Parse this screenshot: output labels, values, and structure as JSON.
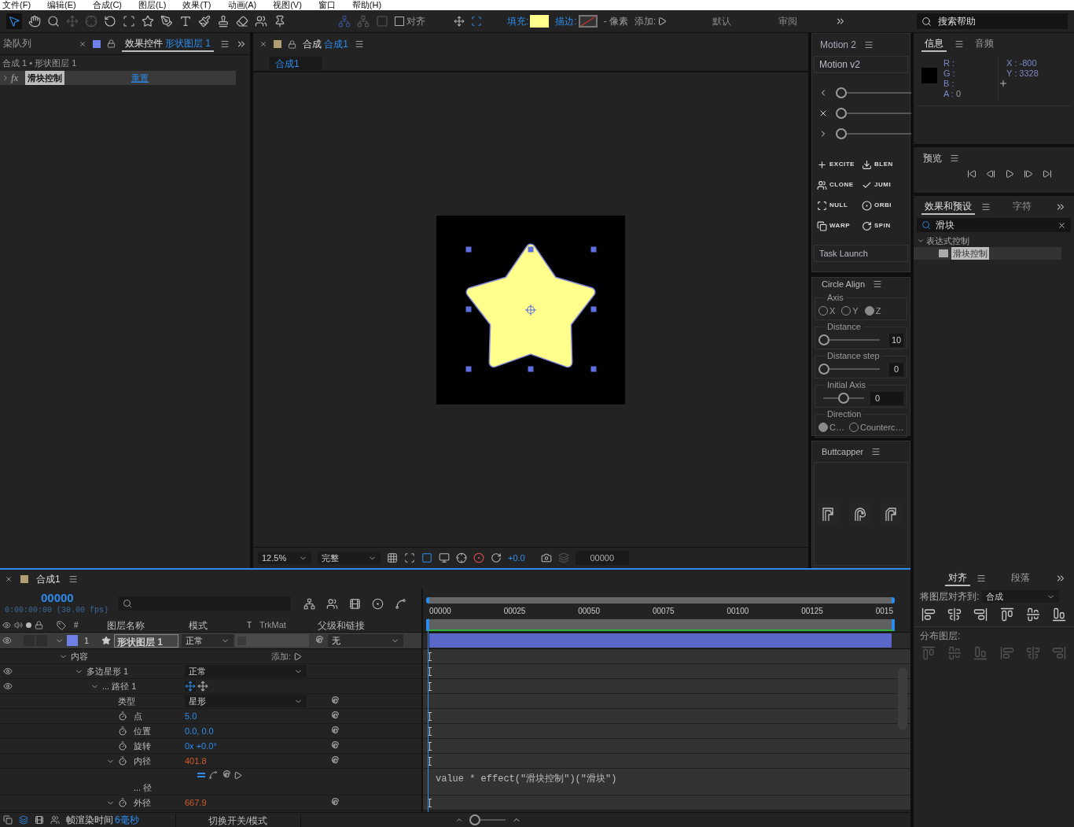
{
  "menu": [
    "文件(F)",
    "编辑(E)",
    "合成(C)",
    "图层(L)",
    "效果(T)",
    "动画(A)",
    "视图(V)",
    "窗口",
    "帮助(H)"
  ],
  "toolbar": {
    "snap": {
      "label": "对齐",
      "checked": false
    },
    "fill_label": "填充:",
    "stroke_label": "描边:",
    "stroke_width": "- 像素",
    "add_label": "添加:",
    "workspaces": [
      {
        "label": "默认",
        "selected": false
      },
      {
        "label": "审阅",
        "selected": false
      }
    ],
    "search": {
      "placeholder": "搜索帮助"
    }
  },
  "effect_controls": {
    "tabs": [
      {
        "label": "染队列",
        "selected": false
      },
      {
        "label": "效果控件",
        "target": "形状图层 1",
        "selected": true
      }
    ],
    "breadcrumb": "合成 1 • 形状图层 1",
    "effects": [
      {
        "icon_text": "fx",
        "name": "滑块控制",
        "reset": "重置",
        "expanded": false
      }
    ]
  },
  "composition": {
    "tab": {
      "label": "合成",
      "target": "合成1"
    },
    "subtabs": [
      {
        "label": "合成1",
        "selected": true
      }
    ],
    "zoom": "12.5%",
    "resolution": "完整",
    "exposure": "+0.0",
    "timecode": "00000"
  },
  "motion": {
    "title": "Motion 2",
    "header": "Motion v2",
    "sliders": [
      {
        "level": 0
      },
      {
        "level": 0
      },
      {
        "level": 0
      }
    ],
    "tools": [
      "EXCITE",
      "BLEN",
      "CLONE",
      "JUMI",
      "NULL",
      "ORBI",
      "WARP",
      "SPIN"
    ],
    "task_launch": "Task Launch"
  },
  "circle_align": {
    "title": "Circle Align",
    "axis": {
      "label": "Axis",
      "options": [
        {
          "label": "X",
          "selected": false
        },
        {
          "label": "Y",
          "selected": false
        },
        {
          "label": "Z",
          "selected": true
        }
      ]
    },
    "distance": {
      "label": "Distance",
      "level": 0,
      "value": "10"
    },
    "distance_step": {
      "label": "Distance step",
      "level": 0,
      "value": "0"
    },
    "initial_axis": {
      "label": "Initial Axis",
      "level": 0.5,
      "value": "0"
    },
    "direction": {
      "label": "Direction",
      "options": [
        {
          "label": "C…",
          "selected": true
        },
        {
          "label": "Counterc…",
          "selected": false
        }
      ]
    }
  },
  "buttcapper": {
    "title": "Buttcapper"
  },
  "info": {
    "tabs": [
      {
        "label": "信息",
        "selected": true
      },
      {
        "label": "音频",
        "selected": false
      }
    ],
    "channels": [
      {
        "label": "R :"
      },
      {
        "label": "G :"
      },
      {
        "label": "B :"
      },
      {
        "label": "A :",
        "value": "0"
      }
    ],
    "x": "X : -800",
    "y": "Y : 3328"
  },
  "preview": {
    "title": "预览"
  },
  "effects_presets": {
    "tabs": [
      {
        "label": "效果和预设",
        "selected": true
      },
      {
        "label": "字符",
        "selected": false
      }
    ],
    "search": {
      "value": "滑块"
    },
    "tree": [
      {
        "label": "表达式控制",
        "expanded": true,
        "children": [
          {
            "label": "滑块控制",
            "selected": true
          }
        ]
      }
    ]
  },
  "align": {
    "tabs": [
      {
        "label": "对齐",
        "selected": true
      },
      {
        "label": "段落",
        "selected": false
      }
    ],
    "align_to_label": "将图层对齐到:",
    "align_to": "合成",
    "distribute_label": "分布图层:"
  },
  "timeline": {
    "tab": "合成1",
    "timecode": "00000",
    "timecode_detail": "0:00:00:00 (30.00 fps)",
    "columns": [
      "#",
      "图层名称",
      "模式",
      "T",
      "TrkMat",
      "父级和链接"
    ],
    "ruler": [
      "00000",
      "00025",
      "00050",
      "00075",
      "00100",
      "00125",
      "0015"
    ],
    "layers": [
      {
        "index": "1",
        "name": "形状图层 1",
        "mode": "正常",
        "parent": "无",
        "expanded": true,
        "selected": true,
        "color": "#6f80e6",
        "properties": [
          {
            "label": "内容",
            "kind": "group",
            "action": "添加:",
            "expanded": true,
            "children": [
              {
                "label": "多边星形 1",
                "kind": "blend_mode",
                "value": "正常",
                "eye": true,
                "expanded": true,
                "children": [
                  {
                    "label": "... 路径 1",
                    "kind": "path_icons",
                    "eye": true,
                    "expanded": true,
                    "children": [
                      {
                        "label": "类型",
                        "kind": "select",
                        "value": "星形"
                      },
                      {
                        "label": "点",
                        "kind": "value",
                        "value": "5.0",
                        "stopwatch": true,
                        "expression": false
                      },
                      {
                        "label": "位置",
                        "kind": "value",
                        "value": "0.0, 0.0",
                        "stopwatch": true,
                        "expression": false
                      },
                      {
                        "label": "旋转",
                        "kind": "value",
                        "value": "0x +0.0°",
                        "stopwatch": true,
                        "expression": false
                      },
                      {
                        "label": "内径",
                        "kind": "value",
                        "value": "401.8",
                        "stopwatch": true,
                        "expression": true,
                        "expanded": true,
                        "children": [
                          {
                            "label": "... 径",
                            "kind": "expression",
                            "expression_text": "value * effect(\"滑块控制\")(\"滑块\")"
                          }
                        ]
                      },
                      {
                        "label": "外径",
                        "kind": "value",
                        "value": "667.9",
                        "stopwatch": true,
                        "expression": true,
                        "expanded": true
                      }
                    ]
                  }
                ]
              }
            ]
          }
        ]
      }
    ],
    "zoom": {
      "level": 0
    },
    "render_label": "帧渲染时间",
    "render_time": "6毫秒",
    "toggle_label": "切换开关/模式"
  }
}
